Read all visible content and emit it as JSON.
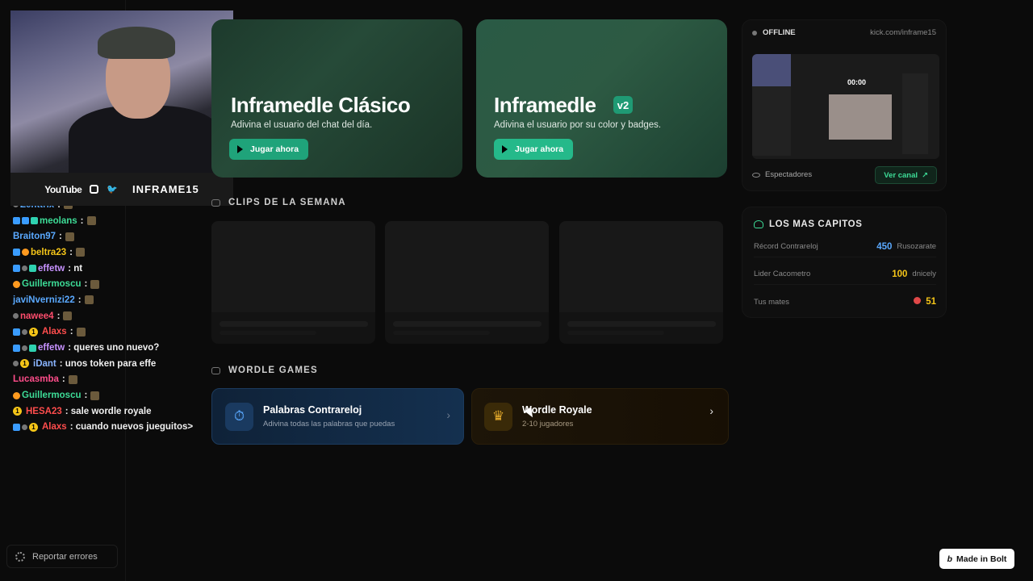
{
  "webcam": {
    "social_youtube": "YouTube",
    "social_instagram": "instagram-icon",
    "social_twitter": "twitter-icon",
    "handle": "INFRAME15"
  },
  "chat": [
    {
      "user": "Zenttrix",
      "color": "#5aa9ff",
      "msg": ""
    },
    {
      "user": "meolans",
      "color": "#3ddc97",
      "msg": ""
    },
    {
      "user": "Braiton97",
      "color": "#5aa9ff",
      "msg": ""
    },
    {
      "user": "beltra23",
      "color": "#f5c518",
      "msg": ""
    },
    {
      "user": "effetw",
      "color": "#c792ff",
      "msg": "nt"
    },
    {
      "user": "Guillermoscu",
      "color": "#3ddc97",
      "msg": ""
    },
    {
      "user": "javiNvernizi22",
      "color": "#5aa9ff",
      "msg": ""
    },
    {
      "user": "nawee4",
      "color": "#ff4d6d",
      "msg": ""
    },
    {
      "user": "Alaxs",
      "color": "#ff4d4d",
      "msg": ""
    },
    {
      "user": "effetw",
      "color": "#c792ff",
      "msg": "queres uno nuevo?"
    },
    {
      "user": "iDant",
      "color": "#8ab4ff",
      "msg": "unos token para effe"
    },
    {
      "user": "Lucasmba",
      "color": "#ff4d8a",
      "msg": ""
    },
    {
      "user": "Guillermoscu",
      "color": "#3ddc97",
      "msg": ""
    },
    {
      "user": "HESA23",
      "color": "#ff4d4d",
      "msg": "sale wordle royale"
    },
    {
      "user": "Alaxs",
      "color": "#ff4d4d",
      "msg": "cuando nuevos jueguitos>"
    }
  ],
  "report_label": "Reportar errores",
  "hero": {
    "classic_title": "Inframedle Clásico",
    "classic_sub": "Adivina el usuario del chat del día.",
    "classic_play": "Jugar ahora",
    "v2_title": "Inframedle",
    "v2_badge": "v2",
    "v2_sub": "Adivina el usuario por su color y badges.",
    "v2_play": "Jugar ahora"
  },
  "clips_header": "CLIPS DE LA SEMANA",
  "wordle_header": "WORDLE GAMES",
  "games": [
    {
      "title": "Palabras Contrareloj",
      "sub": "Adivina todas las palabras que puedas"
    },
    {
      "title": "Wordle Royale",
      "sub": "2-10 jugadores"
    }
  ],
  "live": {
    "status": "OFFLINE",
    "url": "kick.com/inframe15",
    "timer": "00:00",
    "viewers_label": "Espectadores",
    "channel_button": "Ver canal"
  },
  "stats": {
    "title": "LOS MAS CAPITOS",
    "rows": [
      {
        "label": "Récord Contrareloj",
        "value": "450",
        "who": "Rusozarate"
      },
      {
        "label": "Lider Cacometro",
        "value": "100",
        "who": "dnicely"
      },
      {
        "label": "Tus mates",
        "value": "51",
        "who": ""
      }
    ]
  },
  "bolt_label": "Made in Bolt",
  "colors": {
    "accent_green": "#1fa37a",
    "link_green": "#3ddc97",
    "blue": "#5aa9ff",
    "gold": "#f5c518"
  }
}
